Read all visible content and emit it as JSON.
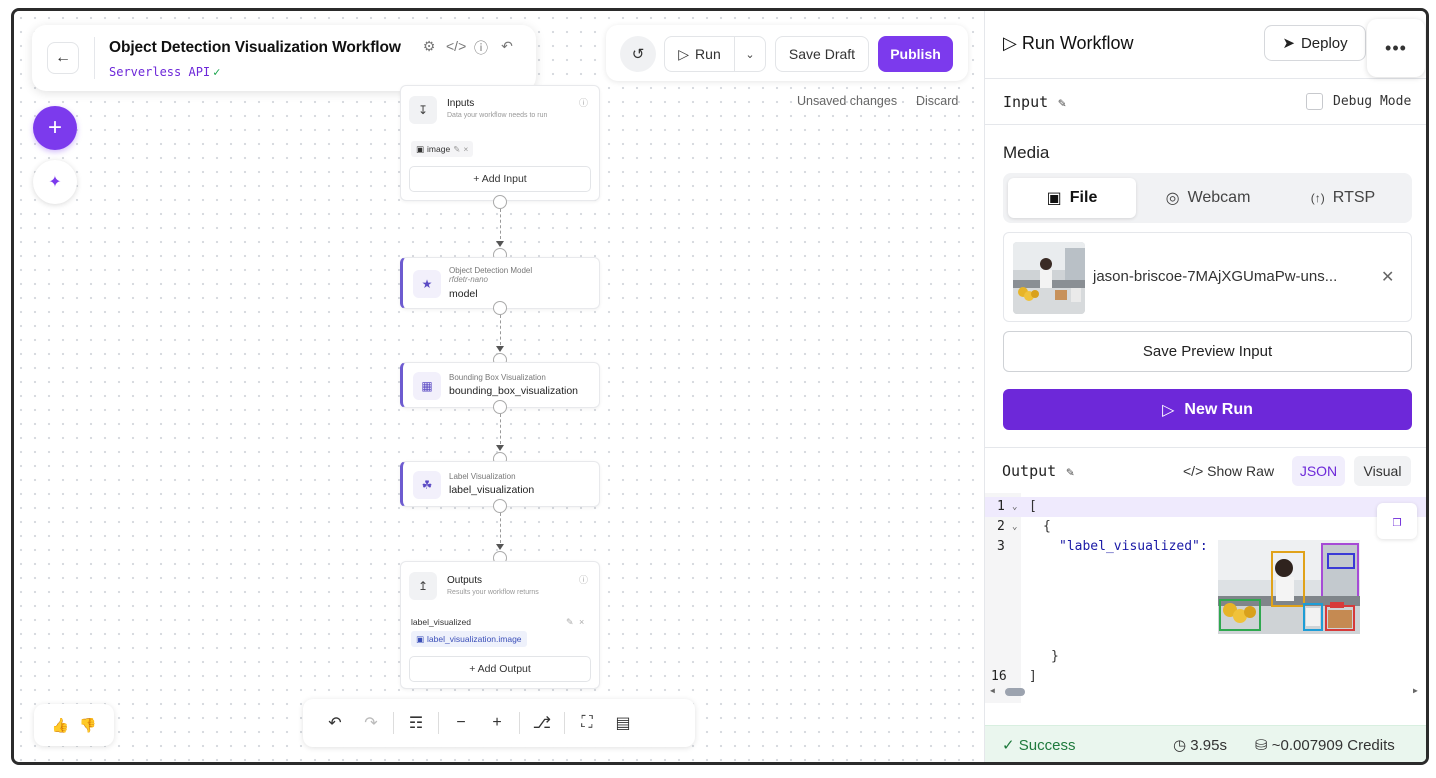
{
  "header": {
    "title": "Object Detection Visualization Workflow",
    "subtitle": "Serverless API",
    "subtitle_check": "✓"
  },
  "toolbar": {
    "run_label": "Run",
    "save_draft_label": "Save Draft",
    "publish_label": "Publish",
    "unsaved_text": "Unsaved changes",
    "discard_label": "Discard"
  },
  "workflow": {
    "inputs_node": {
      "title": "Inputs",
      "description": "Data your workflow needs to run",
      "chip": "image",
      "add_label": "+ Add Input"
    },
    "model_node": {
      "kind": "Object Detection Model",
      "model_id": "rfdetr-nano",
      "name": "model"
    },
    "bbox_node": {
      "kind": "Bounding Box Visualization",
      "name": "bounding_box_visualization"
    },
    "label_node": {
      "kind": "Label Visualization",
      "name": "label_visualization"
    },
    "outputs_node": {
      "title": "Outputs",
      "description": "Results your workflow returns",
      "output_name": "label_visualized",
      "output_ref": "label_visualization.image",
      "add_label": "+ Add Output"
    }
  },
  "panel": {
    "title": "Run Workflow",
    "deploy_label": "Deploy",
    "input_label": "Input",
    "debug_label": "Debug Mode",
    "media_label": "Media",
    "media_tabs": [
      "File",
      "Webcam",
      "RTSP"
    ],
    "active_media_tab": "File",
    "file_name": "jason-briscoe-7MAjXGUmaPw-uns...",
    "save_preview_label": "Save Preview Input",
    "new_run_label": "New Run",
    "output_label": "Output",
    "show_raw_label": "Show Raw",
    "output_tabs": [
      "JSON",
      "Visual"
    ],
    "active_output_tab": "JSON"
  },
  "code": {
    "line_numbers": [
      "1",
      "2",
      "3",
      "16"
    ],
    "line1": "[",
    "line2": "{",
    "line3_key": "\"label_visualized\":",
    "line15": "}",
    "line16": "]"
  },
  "status": {
    "result": "Success",
    "duration": "3.95s",
    "credits": "~0.007909 Credits"
  },
  "colors": {
    "accent": "#7c3aed",
    "primary_button": "#6d28d9",
    "success": "#1f7a3d",
    "status_bg": "#eaf6ee"
  }
}
